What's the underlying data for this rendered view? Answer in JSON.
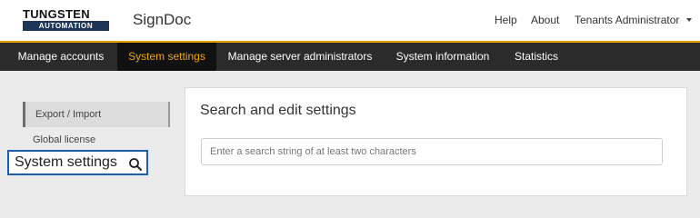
{
  "logo": {
    "top": "TUNGSTEN",
    "bottom": "AUTOMATION"
  },
  "app_name": "SignDoc",
  "header_links": {
    "help": "Help",
    "about": "About",
    "user": "Tenants Administrator"
  },
  "nav": {
    "items": [
      {
        "label": "Manage accounts",
        "active": false
      },
      {
        "label": "System settings",
        "active": true
      },
      {
        "label": "Manage server administrators",
        "active": false
      },
      {
        "label": "System information",
        "active": false
      },
      {
        "label": "Statistics",
        "active": false
      }
    ]
  },
  "sidebar": {
    "items": [
      {
        "label": "Export / Import",
        "active": true
      },
      {
        "label": "Global license",
        "active": false
      }
    ]
  },
  "callout": {
    "label": "System settings",
    "icon": "magnifier-icon"
  },
  "main": {
    "title": "Search and edit settings",
    "search_placeholder": "Enter a search string of at least two characters"
  },
  "colors": {
    "nav_bg": "#2b2b2b",
    "nav_active_bg": "#111111",
    "nav_active_text": "#f0a30a",
    "accent_line": "#e8a300",
    "callout_border": "#1f5fa8",
    "logo_band": "#1d3557"
  }
}
